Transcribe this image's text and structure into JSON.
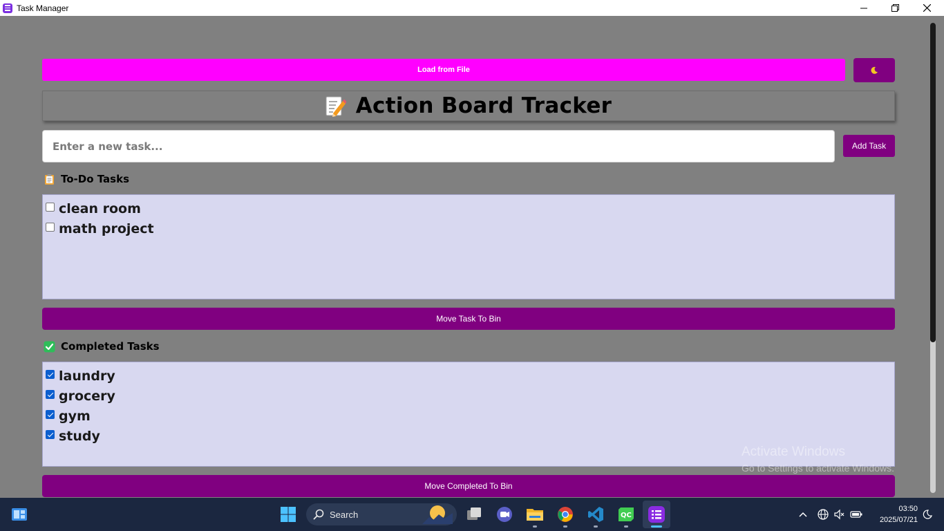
{
  "window": {
    "title": "Task Manager",
    "controls": {
      "minimize": "—",
      "maximize": "❐",
      "close": "✕"
    }
  },
  "toolbar": {
    "load_label": "Load from File",
    "theme_icon": "moon-icon",
    "load_color": "#ff00ff",
    "accent_color": "#800080"
  },
  "header": {
    "title": "Action Board Tracker",
    "icon": "memo-icon"
  },
  "task_input": {
    "value": "",
    "placeholder": "Enter a new task...",
    "add_label": "Add Task"
  },
  "todo": {
    "label": "To-Do Tasks",
    "icon": "clipboard-icon",
    "items": [
      {
        "text": "clean room",
        "checked": false
      },
      {
        "text": "math project",
        "checked": false
      }
    ],
    "bin_label": "Move Task To Bin"
  },
  "completed": {
    "label": "Completed Tasks",
    "icon": "check-mark-icon",
    "items": [
      {
        "text": "laundry",
        "checked": true
      },
      {
        "text": "grocery",
        "checked": true
      },
      {
        "text": "gym",
        "checked": true
      },
      {
        "text": "study",
        "checked": true
      }
    ],
    "bin_label": "Move Completed To Bin"
  },
  "watermark": {
    "line1": "Activate Windows",
    "line2": "Go to Settings to activate Windows."
  },
  "taskbar": {
    "search_label": "Search",
    "time": "03:50",
    "date": "2025/07/21"
  }
}
